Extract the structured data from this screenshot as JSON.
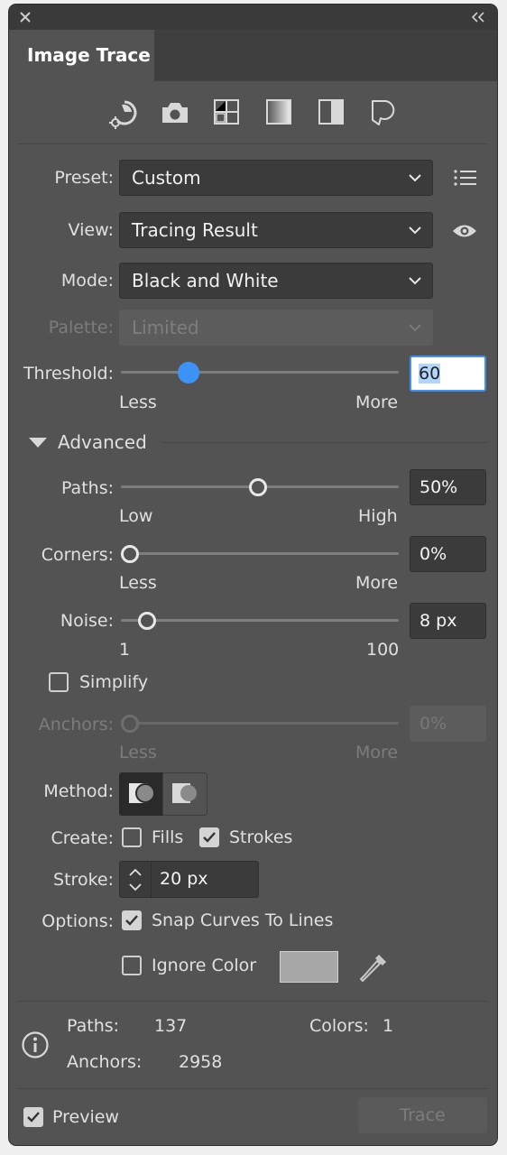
{
  "panel": {
    "tab_title": "Image Trace"
  },
  "icons": [
    "auto-color-preset-icon",
    "high-color-preset-icon",
    "low-color-preset-icon",
    "grayscale-preset-icon",
    "black-white-preset-icon",
    "outline-preset-icon"
  ],
  "preset": {
    "label": "Preset:",
    "value": "Custom"
  },
  "view": {
    "label": "View:",
    "value": "Tracing Result"
  },
  "mode": {
    "label": "Mode:",
    "value": "Black and White"
  },
  "palette": {
    "label": "Palette:",
    "value": "Limited"
  },
  "threshold": {
    "label": "Threshold:",
    "value": "60",
    "fraction": 0.3,
    "min_label": "Less",
    "max_label": "More"
  },
  "advanced": {
    "label": "Advanced"
  },
  "paths": {
    "label": "Paths:",
    "value": "50%",
    "fraction": 0.5,
    "min_label": "Low",
    "max_label": "High"
  },
  "corners": {
    "label": "Corners:",
    "value": "0%",
    "fraction": 0.0,
    "min_label": "Less",
    "max_label": "More"
  },
  "noise": {
    "label": "Noise:",
    "value": "8 px",
    "fraction": 0.07,
    "min_label": "1",
    "max_label": "100"
  },
  "simplify": {
    "label": "Simplify",
    "checked": false
  },
  "anchors": {
    "label": "Anchors:",
    "value": "0%",
    "fraction": 0.0,
    "min_label": "Less",
    "max_label": "More"
  },
  "method": {
    "label": "Method:"
  },
  "create": {
    "label": "Create:",
    "fills_label": "Fills",
    "fills_checked": false,
    "strokes_label": "Strokes",
    "strokes_checked": true
  },
  "stroke": {
    "label": "Stroke:",
    "value": "20 px"
  },
  "options": {
    "label": "Options:",
    "snap_label": "Snap Curves To Lines",
    "snap_checked": true,
    "ignore_label": "Ignore Color",
    "ignore_checked": false,
    "swatch_color": "#a7a7a7"
  },
  "info": {
    "paths_label": "Paths:",
    "paths_value": "137",
    "colors_label": "Colors:",
    "colors_value": "1",
    "anchors_label": "Anchors:",
    "anchors_value": "2958"
  },
  "footer": {
    "preview_label": "Preview",
    "preview_checked": true,
    "trace_label": "Trace"
  },
  "colors": {
    "panel_bg": "#535353",
    "accent": "#3d93f5",
    "field_bg": "#3b3b3b"
  }
}
